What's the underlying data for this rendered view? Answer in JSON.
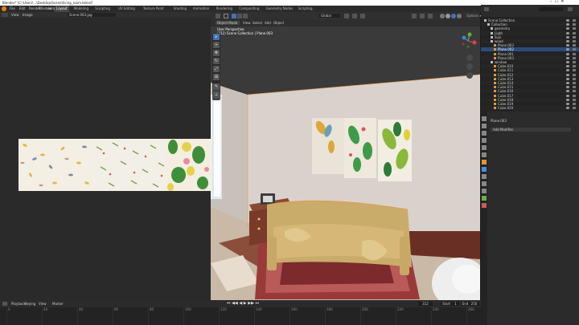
{
  "window_title": "Blender* [C:\\Users\\...\\Desktop\\Scene\\living_room.blend]",
  "menu": [
    "File",
    "Edit",
    "Render",
    "Window",
    "Help"
  ],
  "workspaces": [
    "Layout",
    "Modeling",
    "Sculpting",
    "UV Editing",
    "Texture Paint",
    "Shading",
    "Animation",
    "Rendering",
    "Compositing",
    "Geometry Nodes",
    "Scripting"
  ],
  "active_workspace": "Layout",
  "image_editor": {
    "menu": [
      "View",
      "Image"
    ],
    "image_name": "Scene.003.jpg"
  },
  "viewport": {
    "mode": "Object Mode",
    "menu": [
      "View",
      "Select",
      "Add",
      "Object"
    ],
    "orientation": "Global",
    "perspective_label": "User Perspective",
    "collection_label": "(312) Scene Collection | Plane.003"
  },
  "tools": [
    "cursor-icon",
    "move-icon",
    "rotate-icon",
    "scale-icon",
    "transform-icon",
    "annotate-icon",
    "measure-icon",
    "add-cube-icon"
  ],
  "scene": {
    "name": "Scene",
    "view_layer": "View Layer"
  },
  "outliner": [
    {
      "label": "Scene Collection",
      "indent": 0
    },
    {
      "label": "Collection",
      "indent": 1
    },
    {
      "label": "geometry",
      "indent": 2
    },
    {
      "label": "Light",
      "indent": 2
    },
    {
      "label": "Suzi",
      "indent": 2
    },
    {
      "label": "wood",
      "indent": 2
    },
    {
      "label": "Plane.003",
      "indent": 3
    },
    {
      "label": "Plane.002",
      "indent": 3,
      "selected": true
    },
    {
      "label": "Plane.001",
      "indent": 3
    },
    {
      "label": "Plane.003",
      "indent": 3
    },
    {
      "label": "window",
      "indent": 2
    },
    {
      "label": "Cube.010",
      "indent": 3
    },
    {
      "label": "Cube.011",
      "indent": 3
    },
    {
      "label": "Cube.012",
      "indent": 3
    },
    {
      "label": "Cube.013",
      "indent": 3
    },
    {
      "label": "Cube.014",
      "indent": 3
    },
    {
      "label": "Cube.015",
      "indent": 3
    },
    {
      "label": "Cube.016",
      "indent": 3
    },
    {
      "label": "Cube.017",
      "indent": 3
    },
    {
      "label": "Cube.018",
      "indent": 3
    },
    {
      "label": "Cube.019",
      "indent": 3
    },
    {
      "label": "Cube.020",
      "indent": 3
    }
  ],
  "properties": {
    "object_name": "Plane.003",
    "panel_label": "Add Modifier"
  },
  "timeline": {
    "menu": [
      "Playback",
      "Keying",
      "View",
      "Marker"
    ],
    "frame_ticks": [
      "0",
      "20",
      "40",
      "60",
      "80",
      "100",
      "120",
      "140",
      "160",
      "180",
      "200",
      "220",
      "240",
      "260"
    ],
    "current_frame": "312",
    "start_label": "Start",
    "start": "1",
    "end_label": "End",
    "end": "250"
  },
  "colors": {
    "selected": "#2d4a7a",
    "accent": "#4772b3",
    "active_object": "#f0a040"
  }
}
